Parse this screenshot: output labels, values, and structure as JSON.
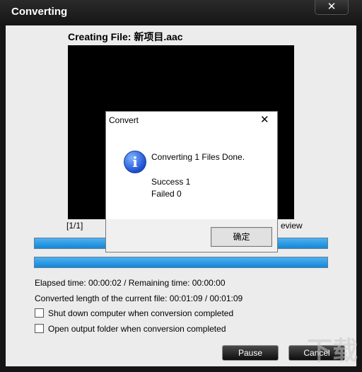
{
  "window": {
    "title": "Converting",
    "close_glyph": "✕"
  },
  "main": {
    "creating_file": "Creating File: 新项目.aac",
    "counter": "[1/1]",
    "preview_label": "eview",
    "progress_bar_1": {
      "fraction": 1.0
    },
    "progress_bar_2": {
      "fraction": 1.0
    },
    "elapsed": "Elapsed time:  00:00:02 / Remaining time:  00:00:00",
    "converted_length": "Converted length of the current file:  00:01:09 / 00:01:09",
    "shutdown_label": "Shut down computer when conversion completed",
    "shutdown_checked": false,
    "open_folder_label": "Open output folder when conversion completed",
    "open_folder_checked": false,
    "pause_label": "Pause",
    "cancel_label": "Cancel"
  },
  "dialog": {
    "title": "Convert",
    "close_glyph": "✕",
    "icon": "info-icon",
    "icon_glyph": "i",
    "message": "Converting 1 Files Done.",
    "success": "Success 1",
    "failed": "Failed 0",
    "ok_label": "确定"
  },
  "colors": {
    "progress_fill": "#1487d6",
    "title_bar": "#161616",
    "info_icon": "#1d4fd1"
  }
}
